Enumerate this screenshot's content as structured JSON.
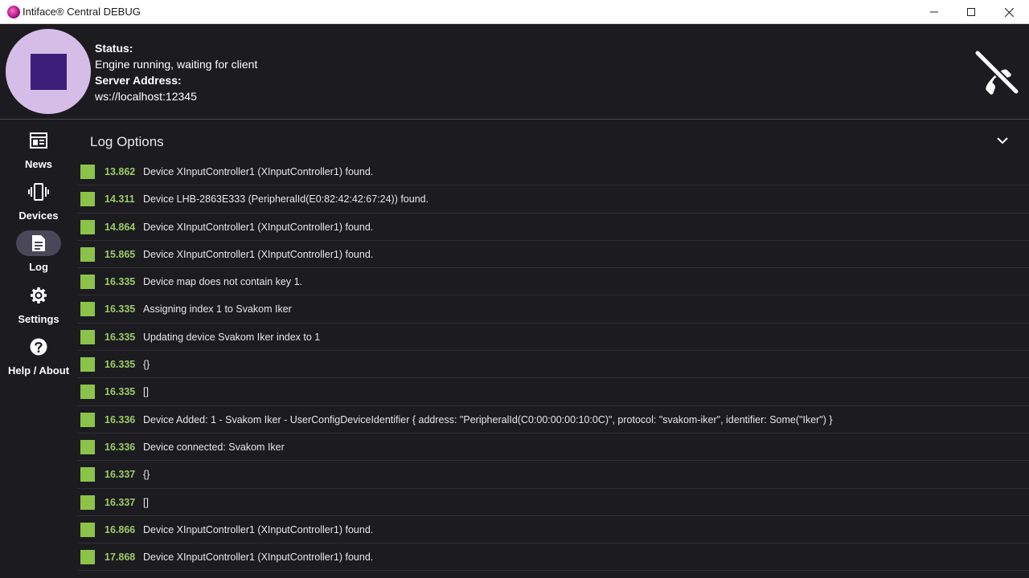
{
  "window": {
    "title": "Intiface® Central DEBUG"
  },
  "header": {
    "status_label": "Status:",
    "status_value": "Engine running, waiting for client",
    "server_label": "Server Address:",
    "server_value": "ws://localhost:12345"
  },
  "sidebar": {
    "items": [
      {
        "label": "News",
        "icon": "news-icon"
      },
      {
        "label": "Devices",
        "icon": "vibration-icon"
      },
      {
        "label": "Log",
        "icon": "log-icon",
        "active": true
      },
      {
        "label": "Settings",
        "icon": "gear-icon"
      },
      {
        "label": "Help / About",
        "icon": "help-icon"
      }
    ]
  },
  "log": {
    "options_label": "Log Options",
    "entries": [
      {
        "time": "13.862",
        "message": "Device XInputController1 (XInputController1) found."
      },
      {
        "time": "14.311",
        "message": "Device LHB-2863E333 (PeripheralId(E0:82:42:42:67:24)) found."
      },
      {
        "time": "14.864",
        "message": "Device XInputController1 (XInputController1) found."
      },
      {
        "time": "15.865",
        "message": "Device XInputController1 (XInputController1) found."
      },
      {
        "time": "16.335",
        "message": "Device map does not contain key 1."
      },
      {
        "time": "16.335",
        "message": "Assigning index 1 to Svakom Iker"
      },
      {
        "time": "16.335",
        "message": "Updating device Svakom Iker index to 1"
      },
      {
        "time": "16.335",
        "message": "{}"
      },
      {
        "time": "16.335",
        "message": "[]"
      },
      {
        "time": "16.336",
        "message": "Device Added: 1 - Svakom Iker - UserConfigDeviceIdentifier { address: \"PeripheralId(C0:00:00:00:10:0C)\", protocol: \"svakom-iker\", identifier: Some(\"Iker\") }"
      },
      {
        "time": "16.336",
        "message": "Device connected: Svakom Iker"
      },
      {
        "time": "16.337",
        "message": "{}"
      },
      {
        "time": "16.337",
        "message": "[]"
      },
      {
        "time": "16.866",
        "message": "Device XInputController1 (XInputController1) found."
      },
      {
        "time": "17.868",
        "message": "Device XInputController1 (XInputController1) found."
      }
    ]
  },
  "colors": {
    "background": "#1c1b20",
    "status_circle": "#d6bde8",
    "status_square": "#3d1f7a",
    "log_marker": "#8bc34a",
    "timestamp": "#9ccc65",
    "active_nav": "#4a4759"
  }
}
